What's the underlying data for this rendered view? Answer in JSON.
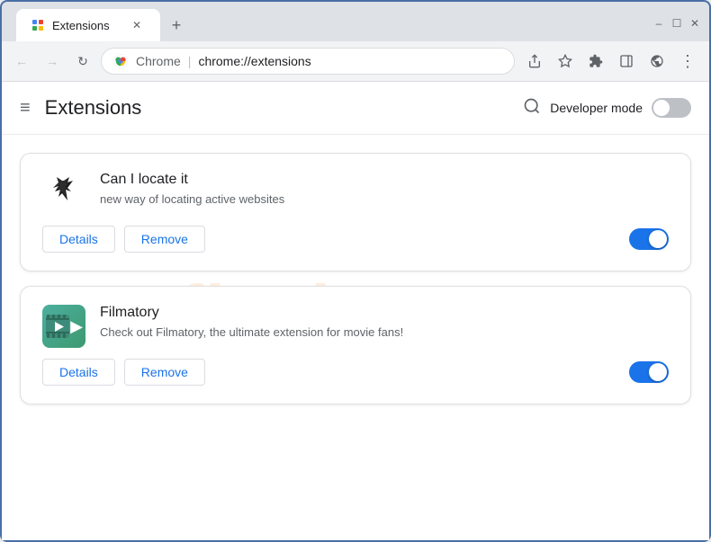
{
  "window": {
    "controls": {
      "minimize": "–",
      "maximize": "☐",
      "close": "✕"
    }
  },
  "tab": {
    "label": "Extensions",
    "close": "✕"
  },
  "new_tab_btn": "+",
  "nav": {
    "back": "←",
    "forward": "→",
    "refresh": "↻"
  },
  "addressbar": {
    "browser_name": "Chrome",
    "url": "chrome://extensions"
  },
  "toolbar": {
    "share_icon": "⬆",
    "bookmark_icon": "☆",
    "extensions_icon": "⊞",
    "sidebar_icon": "▣",
    "profile_icon": "👤",
    "menu_icon": "⋮"
  },
  "header": {
    "hamburger": "≡",
    "title": "Extensions",
    "search_icon": "🔍",
    "dev_mode_label": "Developer mode"
  },
  "extensions": [
    {
      "name": "Can I locate it",
      "description": "new way of locating active websites",
      "details_btn": "Details",
      "remove_btn": "Remove",
      "enabled": true
    },
    {
      "name": "Filmatory",
      "description": "Check out Filmatory, the ultimate extension for movie fans!",
      "details_btn": "Details",
      "remove_btn": "Remove",
      "enabled": true
    }
  ],
  "watermark": "flash.com"
}
